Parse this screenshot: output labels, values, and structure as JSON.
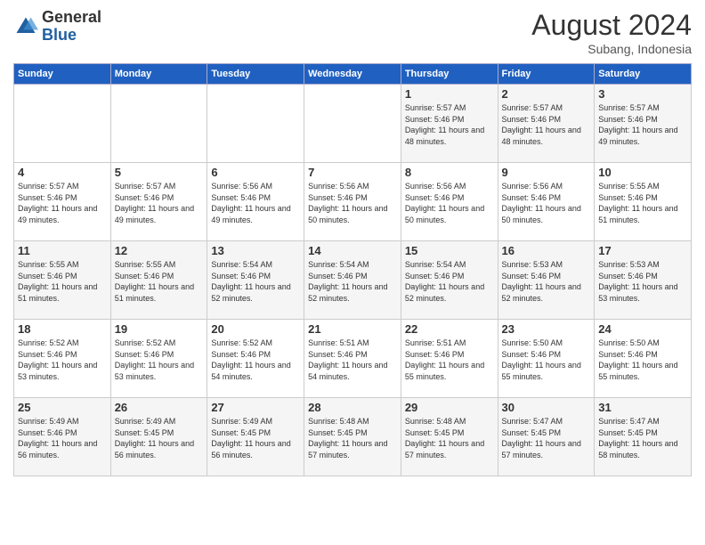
{
  "logo": {
    "general": "General",
    "blue": "Blue"
  },
  "header": {
    "month": "August 2024",
    "location": "Subang, Indonesia"
  },
  "days_of_week": [
    "Sunday",
    "Monday",
    "Tuesday",
    "Wednesday",
    "Thursday",
    "Friday",
    "Saturday"
  ],
  "weeks": [
    [
      {
        "day": "",
        "info": ""
      },
      {
        "day": "",
        "info": ""
      },
      {
        "day": "",
        "info": ""
      },
      {
        "day": "",
        "info": ""
      },
      {
        "day": "1",
        "info": "Sunrise: 5:57 AM\nSunset: 5:46 PM\nDaylight: 11 hours\nand 48 minutes."
      },
      {
        "day": "2",
        "info": "Sunrise: 5:57 AM\nSunset: 5:46 PM\nDaylight: 11 hours\nand 48 minutes."
      },
      {
        "day": "3",
        "info": "Sunrise: 5:57 AM\nSunset: 5:46 PM\nDaylight: 11 hours\nand 49 minutes."
      }
    ],
    [
      {
        "day": "4",
        "info": "Sunrise: 5:57 AM\nSunset: 5:46 PM\nDaylight: 11 hours\nand 49 minutes."
      },
      {
        "day": "5",
        "info": "Sunrise: 5:57 AM\nSunset: 5:46 PM\nDaylight: 11 hours\nand 49 minutes."
      },
      {
        "day": "6",
        "info": "Sunrise: 5:56 AM\nSunset: 5:46 PM\nDaylight: 11 hours\nand 49 minutes."
      },
      {
        "day": "7",
        "info": "Sunrise: 5:56 AM\nSunset: 5:46 PM\nDaylight: 11 hours\nand 50 minutes."
      },
      {
        "day": "8",
        "info": "Sunrise: 5:56 AM\nSunset: 5:46 PM\nDaylight: 11 hours\nand 50 minutes."
      },
      {
        "day": "9",
        "info": "Sunrise: 5:56 AM\nSunset: 5:46 PM\nDaylight: 11 hours\nand 50 minutes."
      },
      {
        "day": "10",
        "info": "Sunrise: 5:55 AM\nSunset: 5:46 PM\nDaylight: 11 hours\nand 51 minutes."
      }
    ],
    [
      {
        "day": "11",
        "info": "Sunrise: 5:55 AM\nSunset: 5:46 PM\nDaylight: 11 hours\nand 51 minutes."
      },
      {
        "day": "12",
        "info": "Sunrise: 5:55 AM\nSunset: 5:46 PM\nDaylight: 11 hours\nand 51 minutes."
      },
      {
        "day": "13",
        "info": "Sunrise: 5:54 AM\nSunset: 5:46 PM\nDaylight: 11 hours\nand 52 minutes."
      },
      {
        "day": "14",
        "info": "Sunrise: 5:54 AM\nSunset: 5:46 PM\nDaylight: 11 hours\nand 52 minutes."
      },
      {
        "day": "15",
        "info": "Sunrise: 5:54 AM\nSunset: 5:46 PM\nDaylight: 11 hours\nand 52 minutes."
      },
      {
        "day": "16",
        "info": "Sunrise: 5:53 AM\nSunset: 5:46 PM\nDaylight: 11 hours\nand 52 minutes."
      },
      {
        "day": "17",
        "info": "Sunrise: 5:53 AM\nSunset: 5:46 PM\nDaylight: 11 hours\nand 53 minutes."
      }
    ],
    [
      {
        "day": "18",
        "info": "Sunrise: 5:52 AM\nSunset: 5:46 PM\nDaylight: 11 hours\nand 53 minutes."
      },
      {
        "day": "19",
        "info": "Sunrise: 5:52 AM\nSunset: 5:46 PM\nDaylight: 11 hours\nand 53 minutes."
      },
      {
        "day": "20",
        "info": "Sunrise: 5:52 AM\nSunset: 5:46 PM\nDaylight: 11 hours\nand 54 minutes."
      },
      {
        "day": "21",
        "info": "Sunrise: 5:51 AM\nSunset: 5:46 PM\nDaylight: 11 hours\nand 54 minutes."
      },
      {
        "day": "22",
        "info": "Sunrise: 5:51 AM\nSunset: 5:46 PM\nDaylight: 11 hours\nand 55 minutes."
      },
      {
        "day": "23",
        "info": "Sunrise: 5:50 AM\nSunset: 5:46 PM\nDaylight: 11 hours\nand 55 minutes."
      },
      {
        "day": "24",
        "info": "Sunrise: 5:50 AM\nSunset: 5:46 PM\nDaylight: 11 hours\nand 55 minutes."
      }
    ],
    [
      {
        "day": "25",
        "info": "Sunrise: 5:49 AM\nSunset: 5:46 PM\nDaylight: 11 hours\nand 56 minutes."
      },
      {
        "day": "26",
        "info": "Sunrise: 5:49 AM\nSunset: 5:45 PM\nDaylight: 11 hours\nand 56 minutes."
      },
      {
        "day": "27",
        "info": "Sunrise: 5:49 AM\nSunset: 5:45 PM\nDaylight: 11 hours\nand 56 minutes."
      },
      {
        "day": "28",
        "info": "Sunrise: 5:48 AM\nSunset: 5:45 PM\nDaylight: 11 hours\nand 57 minutes."
      },
      {
        "day": "29",
        "info": "Sunrise: 5:48 AM\nSunset: 5:45 PM\nDaylight: 11 hours\nand 57 minutes."
      },
      {
        "day": "30",
        "info": "Sunrise: 5:47 AM\nSunset: 5:45 PM\nDaylight: 11 hours\nand 57 minutes."
      },
      {
        "day": "31",
        "info": "Sunrise: 5:47 AM\nSunset: 5:45 PM\nDaylight: 11 hours\nand 58 minutes."
      }
    ]
  ]
}
